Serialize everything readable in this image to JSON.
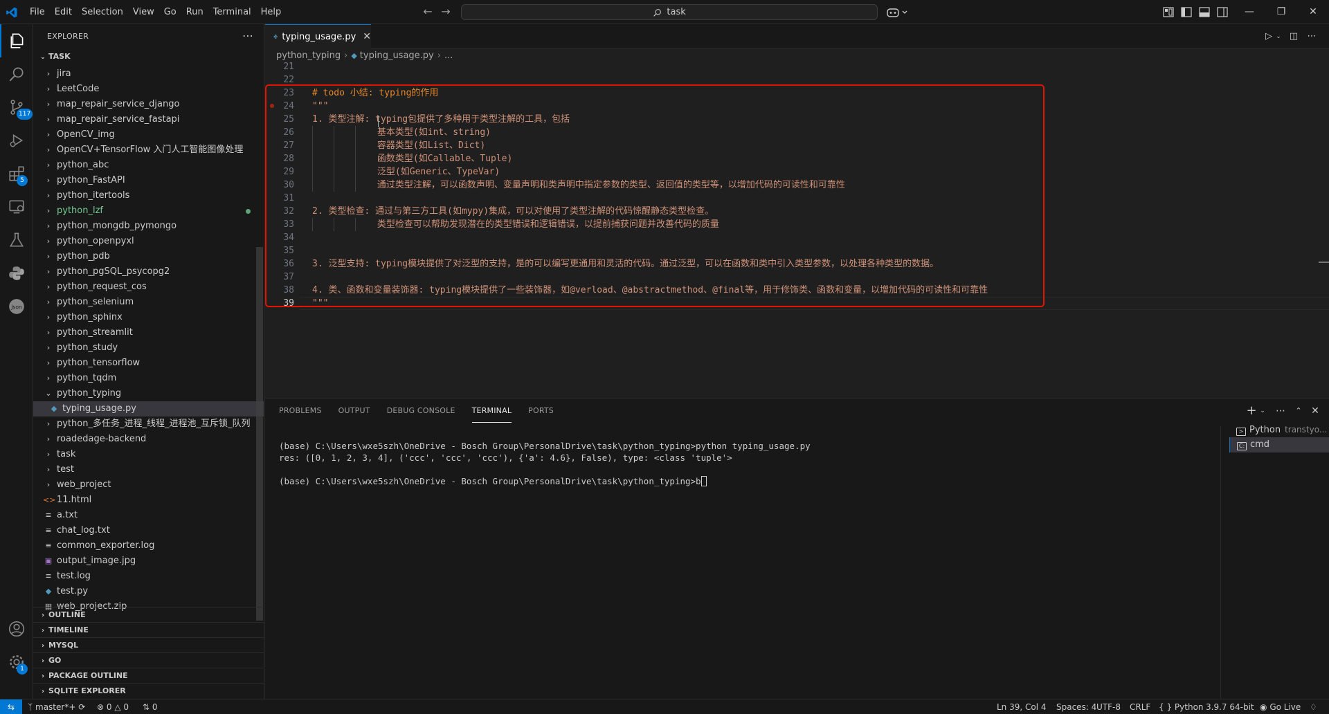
{
  "titlebar": {
    "menus": [
      "File",
      "Edit",
      "Selection",
      "View",
      "Go",
      "Run",
      "Terminal",
      "Help"
    ],
    "search_text": "task"
  },
  "activity_badges": {
    "source_control": "117",
    "extensions": "5",
    "settings": "1"
  },
  "sidebar": {
    "title": "EXPLORER",
    "root": "TASK",
    "tree": [
      {
        "label": "jira",
        "kind": "folder"
      },
      {
        "label": "LeetCode",
        "kind": "folder"
      },
      {
        "label": "map_repair_service_django",
        "kind": "folder"
      },
      {
        "label": "map_repair_service_fastapi",
        "kind": "folder"
      },
      {
        "label": "OpenCV_img",
        "kind": "folder"
      },
      {
        "label": "OpenCV+TensorFlow 入门人工智能图像处理",
        "kind": "folder"
      },
      {
        "label": "python_abc",
        "kind": "folder"
      },
      {
        "label": "python_FastAPI",
        "kind": "folder"
      },
      {
        "label": "python_itertools",
        "kind": "folder"
      },
      {
        "label": "python_lzf",
        "kind": "folder",
        "modified": true
      },
      {
        "label": "python_mongdb_pymongo",
        "kind": "folder"
      },
      {
        "label": "python_openpyxl",
        "kind": "folder"
      },
      {
        "label": "python_pdb",
        "kind": "folder"
      },
      {
        "label": "python_pgSQL_psycopg2",
        "kind": "folder"
      },
      {
        "label": "python_request_cos",
        "kind": "folder"
      },
      {
        "label": "python_selenium",
        "kind": "folder"
      },
      {
        "label": "python_sphinx",
        "kind": "folder"
      },
      {
        "label": "python_streamlit",
        "kind": "folder"
      },
      {
        "label": "python_study",
        "kind": "folder"
      },
      {
        "label": "python_tensorflow",
        "kind": "folder"
      },
      {
        "label": "python_tqdm",
        "kind": "folder"
      },
      {
        "label": "python_typing",
        "kind": "folder-open"
      },
      {
        "label": "typing_usage.py",
        "kind": "py-child",
        "selected": true
      },
      {
        "label": "python_多任务_进程_线程_进程池_互斥锁_队列",
        "kind": "folder"
      },
      {
        "label": "roadedage-backend",
        "kind": "folder"
      },
      {
        "label": "task",
        "kind": "folder"
      },
      {
        "label": "test",
        "kind": "folder"
      },
      {
        "label": "web_project",
        "kind": "folder"
      },
      {
        "label": "11.html",
        "kind": "html"
      },
      {
        "label": "a.txt",
        "kind": "txt"
      },
      {
        "label": "chat_log.txt",
        "kind": "txt"
      },
      {
        "label": "common_exporter.log",
        "kind": "txt"
      },
      {
        "label": "output_image.jpg",
        "kind": "img"
      },
      {
        "label": "test.log",
        "kind": "txt"
      },
      {
        "label": "test.py",
        "kind": "py"
      },
      {
        "label": "web_project.zip",
        "kind": "zip"
      }
    ],
    "sections": [
      "OUTLINE",
      "TIMELINE",
      "MYSQL",
      "GO",
      "PACKAGE OUTLINE",
      "SQLITE EXPLORER"
    ]
  },
  "editor": {
    "tab_label": "typing_usage.py",
    "breadcrumb": [
      "python_typing",
      "typing_usage.py",
      "..."
    ],
    "lines": [
      {
        "n": "21",
        "text": ""
      },
      {
        "n": "22",
        "text": ""
      },
      {
        "n": "23",
        "text": "# todo 小结: typing的作用",
        "cls": "todo"
      },
      {
        "n": "24",
        "text": "\"\"\"",
        "cls": "quote"
      },
      {
        "n": "25",
        "text": "1. 类型注解: typing包提供了多种用于类型注解的工具，包括"
      },
      {
        "n": "26",
        "text": "            基本类型(如int、string)"
      },
      {
        "n": "27",
        "text": "            容器类型(如List、Dict)"
      },
      {
        "n": "28",
        "text": "            函数类型(如Callable、Tuple)"
      },
      {
        "n": "29",
        "text": "            泛型(如Generic、TypeVar)"
      },
      {
        "n": "30",
        "text": "            通过类型注解，可以函数声明、变量声明和类声明中指定参数的类型、返回值的类型等，以增加代码的可读性和可靠性"
      },
      {
        "n": "31",
        "text": ""
      },
      {
        "n": "32",
        "text": "2. 类型检查: 通过与第三方工具(如mypy)集成，可以对使用了类型注解的代码惊醒静态类型检查。"
      },
      {
        "n": "33",
        "text": "            类型检查可以帮助发现潜在的类型错误和逻辑错误，以提前捕获问题并改善代码的质量"
      },
      {
        "n": "34",
        "text": ""
      },
      {
        "n": "35",
        "text": ""
      },
      {
        "n": "36",
        "text": "3. 泛型支持: typing模块提供了对泛型的支持，是的可以编写更通用和灵活的代码。通过泛型，可以在函数和类中引入类型参数，以处理各种类型的数据。"
      },
      {
        "n": "37",
        "text": ""
      },
      {
        "n": "38",
        "text": "4. 类、函数和变量装饰器: typing模块提供了一些装饰器，如@verload、@abstractmethod、@final等，用于修饰类、函数和变量，以增加代码的可读性和可靠性"
      },
      {
        "n": "39",
        "text": "\"\"\"",
        "cls": "quote",
        "current": true
      }
    ]
  },
  "panel": {
    "tabs": [
      "PROBLEMS",
      "OUTPUT",
      "DEBUG CONSOLE",
      "TERMINAL",
      "PORTS"
    ],
    "terminal_lines": [
      "(base) C:\\Users\\wxe5szh\\OneDrive - Bosch Group\\PersonalDrive\\task\\python_typing>python typing_usage.py",
      "res: ([0, 1, 2, 3, 4], ('ccc', 'ccc', 'ccc'), {'a': 4.6}, False), type: <class 'tuple'>",
      "",
      "(base) C:\\Users\\wxe5szh\\OneDrive - Bosch Group\\PersonalDrive\\task\\python_typing>b"
    ],
    "terminals": [
      {
        "name": "Python",
        "sub": "transtyo..."
      },
      {
        "name": "cmd",
        "sub": ""
      }
    ]
  },
  "statusbar": {
    "branch": "master*+",
    "errors": "0",
    "warnings": "0",
    "ports": "0",
    "cursor_pos": "Ln 39, Col 4",
    "spaces": "Spaces: 4",
    "encoding": "UTF-8",
    "eol": "CRLF",
    "language": "Python",
    "interpreter": "3.9.7 64-bit",
    "go_live": "Go Live"
  },
  "colors": {
    "accent": "#0078d4",
    "highlight_box": "#e51400",
    "string": "#ce9178",
    "todo": "#e5892d",
    "modified": "#73c991"
  }
}
